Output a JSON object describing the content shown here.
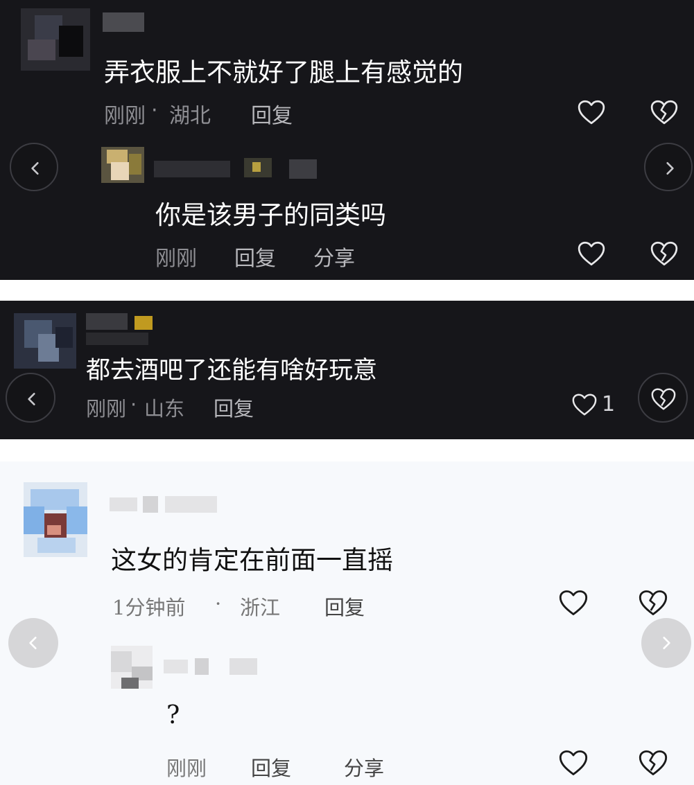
{
  "panel1": {
    "comment": "弄衣服上不就好了腿上有感觉的",
    "meta_time": "刚刚",
    "meta_sep": "·",
    "meta_location": "湖北",
    "reply_label": "回复",
    "reply": {
      "comment": "你是该男子的同类吗",
      "meta_time": "刚刚",
      "reply_label": "回复",
      "share_label": "分享"
    }
  },
  "panel2": {
    "comment": "都去酒吧了还能有啥好玩意",
    "meta_time": "刚刚",
    "meta_sep": "·",
    "meta_location": "山东",
    "reply_label": "回复",
    "like_count": "1"
  },
  "panel3": {
    "comment": "这女的肯定在前面一直摇",
    "meta_time": "1分钟前",
    "meta_sep": "·",
    "meta_location": "浙江",
    "reply_label": "回复",
    "reply": {
      "comment": "?",
      "meta_time": "刚刚",
      "reply_label": "回复",
      "share_label": "分享"
    }
  },
  "icons": {
    "like": "heart-outline-icon",
    "dislike": "broken-heart-icon",
    "prev": "chevron-left-icon",
    "next": "chevron-right-icon"
  },
  "colors": {
    "dark_bg": "#16161a",
    "light_bg": "#f7f9fc",
    "divider": "#ffffff"
  }
}
